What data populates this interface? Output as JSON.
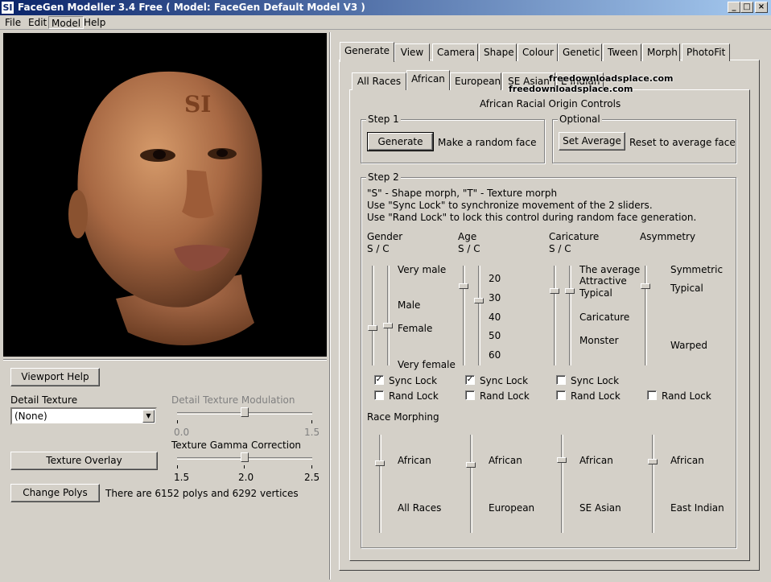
{
  "window": {
    "title": "FaceGen Modeller 3.4 Free  ( Model: FaceGen Default Model V3 )",
    "icon": "SI"
  },
  "menu": [
    "File",
    "Edit",
    "Model",
    "Help"
  ],
  "left": {
    "viewport_help": "Viewport Help",
    "detail_texture_label": "Detail Texture",
    "detail_texture_value": "(None)",
    "dtm_label": "Detail Texture Modulation",
    "dtm_ticks": [
      "0.0",
      "1.5"
    ],
    "dtm_value": 0.75,
    "texture_overlay": "Texture Overlay",
    "tgc_label": "Texture Gamma Correction",
    "tgc_ticks": [
      "1.5",
      "2.0",
      "2.5"
    ],
    "tgc_value": 2.0,
    "change_polys": "Change Polys",
    "polys_info": "There are 6152 polys and 6292 vertices",
    "forehead_mark": "SI"
  },
  "tabs": [
    "Generate",
    "View",
    "Camera",
    "Shape",
    "Colour",
    "Genetic",
    "Tween",
    "Morph",
    "PhotoFit"
  ],
  "subtabs": [
    "All Races",
    "African",
    "European",
    "SE Asian",
    "E Indian"
  ],
  "watermark": [
    "freedownloadsplace.com",
    "freedownloadsplace.com"
  ],
  "panel": {
    "title": "African Racial Origin Controls",
    "step1": {
      "label": "Step 1",
      "button": "Generate",
      "desc": "Make a random face"
    },
    "optional": {
      "label": "Optional",
      "button": "Set Average",
      "desc": "Reset to average face"
    },
    "step2": {
      "label": "Step 2",
      "help": [
        "\"S\" - Shape morph, \"T\" - Texture morph",
        "Use \"Sync Lock\" to synchronize movement of the 2 sliders.",
        "Use \"Rand Lock\" to lock this control during random face generation."
      ]
    },
    "controls": [
      {
        "name": "Gender",
        "sc": "S / C",
        "labels": [
          "Very male",
          "Male",
          "Female",
          "Very female"
        ],
        "sync": true,
        "rand": false
      },
      {
        "name": "Age",
        "sc": "S / C",
        "labels": [
          "20",
          "30",
          "40",
          "50",
          "60"
        ],
        "sync": true,
        "rand": false
      },
      {
        "name": "Caricature",
        "sc": "S / C",
        "labels": [
          "The average",
          "Attractive",
          "Typical",
          "Caricature",
          "Monster"
        ],
        "sync": false,
        "rand": false
      },
      {
        "name": "Asymmetry",
        "sc": "",
        "labels": [
          "Symmetric",
          "Typical",
          "Warped"
        ],
        "rand": false
      }
    ],
    "sync_lock": "Sync Lock",
    "rand_lock": "Rand Lock",
    "race_morphing": "Race Morphing",
    "morphs": [
      {
        "top": "African",
        "bottom": "All Races"
      },
      {
        "top": "African",
        "bottom": "European"
      },
      {
        "top": "African",
        "bottom": "SE Asian"
      },
      {
        "top": "African",
        "bottom": "East Indian"
      }
    ]
  }
}
